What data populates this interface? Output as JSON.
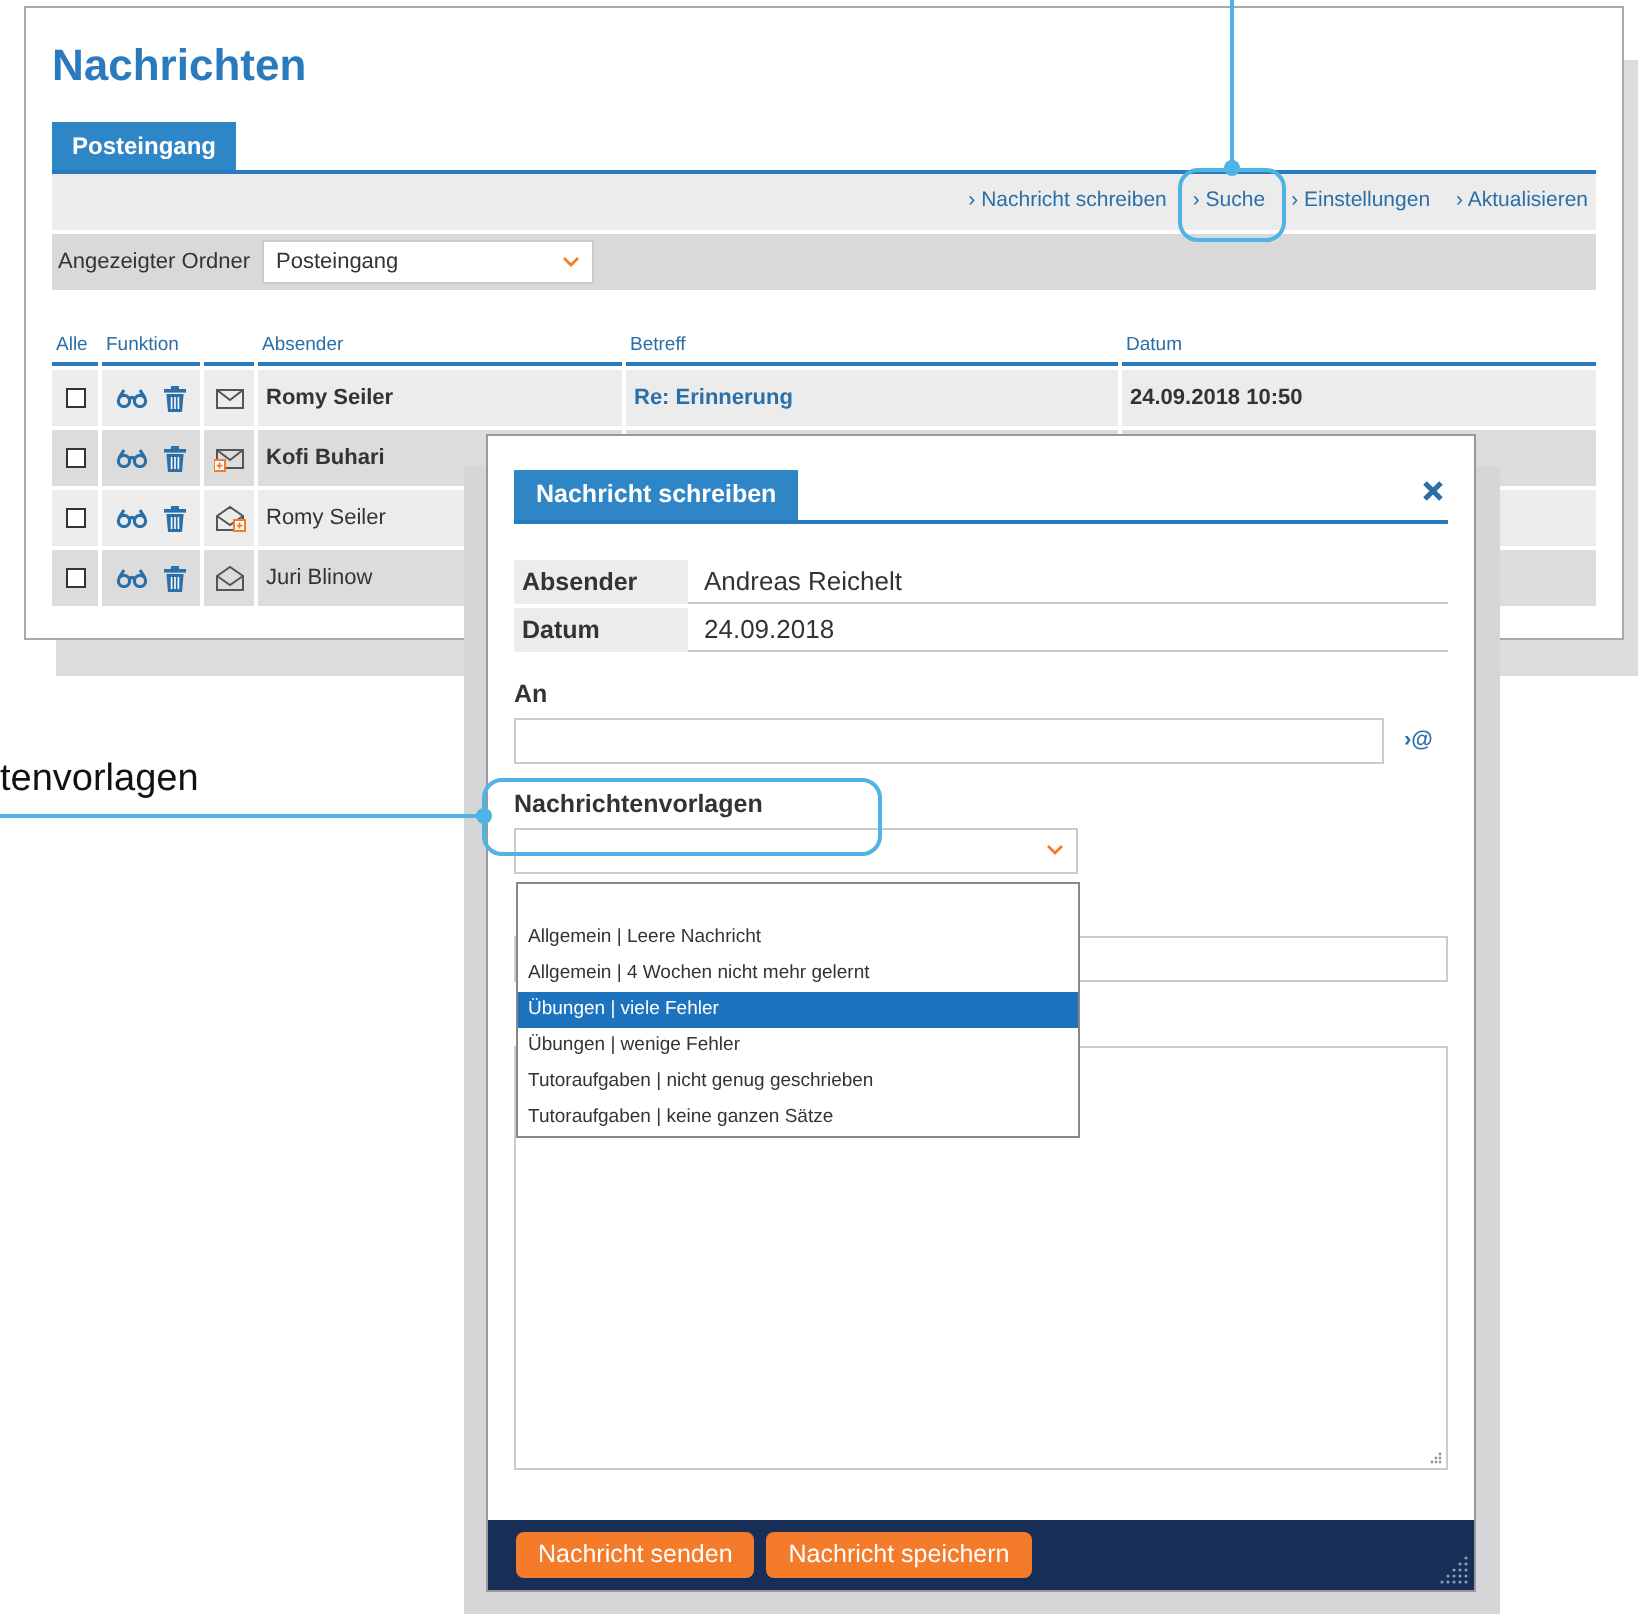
{
  "page": {
    "title": "Nachrichten"
  },
  "tabs": [
    {
      "label": "Posteingang",
      "selected": true
    }
  ],
  "toolbar_links": [
    "› Nachricht schreiben",
    "› Suche",
    "› Einstellungen",
    "› Aktualisieren"
  ],
  "folder": {
    "label": "Angezeigter Ordner",
    "value": "Posteingang"
  },
  "table": {
    "columns": [
      "Alle",
      "Funktion",
      "Absender",
      "Betreff",
      "Datum"
    ],
    "rows": [
      {
        "checked": false,
        "kind": "closed",
        "sender": "Romy Seiler",
        "unread": true,
        "subject": "Re: Erinnerung",
        "date": "24.09.2018 10:50"
      },
      {
        "checked": false,
        "kind": "closed-attachment",
        "sender": "Kofi Buhari",
        "unread": true
      },
      {
        "checked": false,
        "kind": "open-attachment",
        "sender": "Romy Seiler",
        "unread": false
      },
      {
        "checked": false,
        "kind": "open",
        "sender": "Juri Blinow",
        "unread": false
      }
    ]
  },
  "dialog": {
    "title": "Nachricht schreiben",
    "fields": [
      {
        "label": "Absender",
        "value": "Andreas Reichelt"
      },
      {
        "label": "Datum",
        "value": "24.09.2018"
      }
    ],
    "to": {
      "label": "An",
      "link": "›@"
    },
    "templates": {
      "label": "Nachrichtenvorlagen",
      "options": [
        {
          "label": "Allgemein | Leere Nachricht",
          "selected": false
        },
        {
          "label": "Allgemein | 4 Wochen nicht mehr gelernt",
          "selected": false
        },
        {
          "label": "Übungen | viele Fehler",
          "selected": true
        },
        {
          "label": "Übungen | wenige Fehler",
          "selected": false
        },
        {
          "label": "Tutoraufgaben | nicht genug geschrieben",
          "selected": false
        },
        {
          "label": "Tutoraufgaben | keine ganzen Sätze",
          "selected": false
        }
      ]
    },
    "buttons": [
      "Nachricht senden",
      "Nachricht speichern"
    ]
  },
  "callout": {
    "text": "tenvorlagen"
  }
}
